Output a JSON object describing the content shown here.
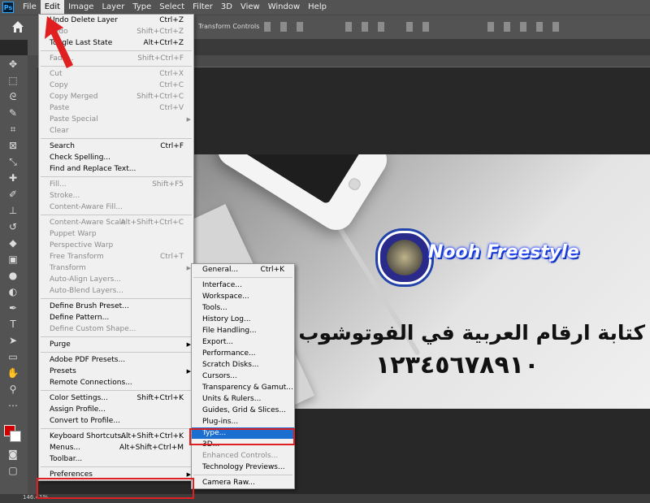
{
  "menubar": {
    "logo": "Ps",
    "items": [
      "File",
      "Edit",
      "Image",
      "Layer",
      "Type",
      "Select",
      "Filter",
      "3D",
      "View",
      "Window",
      "Help"
    ],
    "active": "Edit"
  },
  "options_bar": {
    "transform_controls_label": "Transform Controls"
  },
  "canvas": {
    "logo_text": "Nooh Freestyle",
    "arabic_title": "كتابة ارقام العربية في الفوتوشوب",
    "arabic_digits": "١٢٣٤٥٦٧٨٩١٠"
  },
  "edit_menu": {
    "groups": [
      [
        {
          "label": "Undo Delete Layer",
          "shortcut": "Ctrl+Z",
          "disabled": false
        },
        {
          "label": "Redo",
          "shortcut": "Shift+Ctrl+Z",
          "disabled": true
        },
        {
          "label": "Toggle Last State",
          "shortcut": "Alt+Ctrl+Z",
          "disabled": false
        }
      ],
      [
        {
          "label": "Fade...",
          "shortcut": "Shift+Ctrl+F",
          "disabled": true
        }
      ],
      [
        {
          "label": "Cut",
          "shortcut": "Ctrl+X",
          "disabled": true
        },
        {
          "label": "Copy",
          "shortcut": "Ctrl+C",
          "disabled": true
        },
        {
          "label": "Copy Merged",
          "shortcut": "Shift+Ctrl+C",
          "disabled": true
        },
        {
          "label": "Paste",
          "shortcut": "Ctrl+V",
          "disabled": true
        },
        {
          "label": "Paste Special",
          "shortcut": "",
          "disabled": true,
          "submenu": true
        },
        {
          "label": "Clear",
          "shortcut": "",
          "disabled": true
        }
      ],
      [
        {
          "label": "Search",
          "shortcut": "Ctrl+F",
          "disabled": false
        },
        {
          "label": "Check Spelling...",
          "shortcut": "",
          "disabled": false
        },
        {
          "label": "Find and Replace Text...",
          "shortcut": "",
          "disabled": false
        }
      ],
      [
        {
          "label": "Fill...",
          "shortcut": "Shift+F5",
          "disabled": true
        },
        {
          "label": "Stroke...",
          "shortcut": "",
          "disabled": true
        },
        {
          "label": "Content-Aware Fill...",
          "shortcut": "",
          "disabled": true
        }
      ],
      [
        {
          "label": "Content-Aware Scale",
          "shortcut": "Alt+Shift+Ctrl+C",
          "disabled": true
        },
        {
          "label": "Puppet Warp",
          "shortcut": "",
          "disabled": true
        },
        {
          "label": "Perspective Warp",
          "shortcut": "",
          "disabled": true
        },
        {
          "label": "Free Transform",
          "shortcut": "Ctrl+T",
          "disabled": true
        },
        {
          "label": "Transform",
          "shortcut": "",
          "disabled": true,
          "submenu": true
        },
        {
          "label": "Auto-Align Layers...",
          "shortcut": "",
          "disabled": true
        },
        {
          "label": "Auto-Blend Layers...",
          "shortcut": "",
          "disabled": true
        }
      ],
      [
        {
          "label": "Define Brush Preset...",
          "shortcut": "",
          "disabled": false
        },
        {
          "label": "Define Pattern...",
          "shortcut": "",
          "disabled": false
        },
        {
          "label": "Define Custom Shape...",
          "shortcut": "",
          "disabled": true
        }
      ],
      [
        {
          "label": "Purge",
          "shortcut": "",
          "disabled": false,
          "submenu": true
        }
      ],
      [
        {
          "label": "Adobe PDF Presets...",
          "shortcut": "",
          "disabled": false
        },
        {
          "label": "Presets",
          "shortcut": "",
          "disabled": false,
          "submenu": true
        },
        {
          "label": "Remote Connections...",
          "shortcut": "",
          "disabled": false
        }
      ],
      [
        {
          "label": "Color Settings...",
          "shortcut": "Shift+Ctrl+K",
          "disabled": false
        },
        {
          "label": "Assign Profile...",
          "shortcut": "",
          "disabled": false
        },
        {
          "label": "Convert to Profile...",
          "shortcut": "",
          "disabled": false
        }
      ],
      [
        {
          "label": "Keyboard Shortcuts...",
          "shortcut": "Alt+Shift+Ctrl+K",
          "disabled": false
        },
        {
          "label": "Menus...",
          "shortcut": "Alt+Shift+Ctrl+M",
          "disabled": false
        },
        {
          "label": "Toolbar...",
          "shortcut": "",
          "disabled": false
        }
      ],
      [
        {
          "label": "Preferences",
          "shortcut": "",
          "disabled": false,
          "submenu": true,
          "selected": true
        }
      ]
    ]
  },
  "preferences_menu": {
    "groups": [
      [
        {
          "label": "General...",
          "shortcut": "Ctrl+K",
          "disabled": false
        }
      ],
      [
        {
          "label": "Interface...",
          "shortcut": "",
          "disabled": false
        },
        {
          "label": "Workspace...",
          "shortcut": "",
          "disabled": false
        },
        {
          "label": "Tools...",
          "shortcut": "",
          "disabled": false
        },
        {
          "label": "History Log...",
          "shortcut": "",
          "disabled": false
        },
        {
          "label": "File Handling...",
          "shortcut": "",
          "disabled": false
        },
        {
          "label": "Export...",
          "shortcut": "",
          "disabled": false
        },
        {
          "label": "Performance...",
          "shortcut": "",
          "disabled": false
        },
        {
          "label": "Scratch Disks...",
          "shortcut": "",
          "disabled": false
        },
        {
          "label": "Cursors...",
          "shortcut": "",
          "disabled": false
        },
        {
          "label": "Transparency & Gamut...",
          "shortcut": "",
          "disabled": false
        },
        {
          "label": "Units & Rulers...",
          "shortcut": "",
          "disabled": false
        },
        {
          "label": "Guides, Grid & Slices...",
          "shortcut": "",
          "disabled": false
        },
        {
          "label": "Plug-ins...",
          "shortcut": "",
          "disabled": false
        },
        {
          "label": "Type...",
          "shortcut": "",
          "disabled": false,
          "selected": true
        },
        {
          "label": "3D...",
          "shortcut": "",
          "disabled": false
        },
        {
          "label": "Enhanced Controls...",
          "shortcut": "",
          "disabled": true
        },
        {
          "label": "Technology Previews...",
          "shortcut": "",
          "disabled": false
        }
      ],
      [
        {
          "label": "Camera Raw...",
          "shortcut": "",
          "disabled": false
        }
      ]
    ]
  },
  "colors": {
    "highlight": "#1b6fd1",
    "annotation_red": "#e02020",
    "foreground_swatch": "#d00000",
    "background_swatch": "#ffffff"
  },
  "icons": [
    "home-icon",
    "move-icon",
    "marquee-icon",
    "lasso-icon",
    "quick-select-icon",
    "crop-icon",
    "frame-icon",
    "eyedropper-icon",
    "healing-icon",
    "brush-icon",
    "stamp-icon",
    "history-brush-icon",
    "eraser-icon",
    "gradient-icon",
    "blur-icon",
    "dodge-icon",
    "pen-icon",
    "type-icon",
    "path-select-icon",
    "rectangle-icon",
    "hand-icon",
    "zoom-icon",
    "more-icon"
  ],
  "statusbar": {
    "zoom": "146.41%"
  }
}
